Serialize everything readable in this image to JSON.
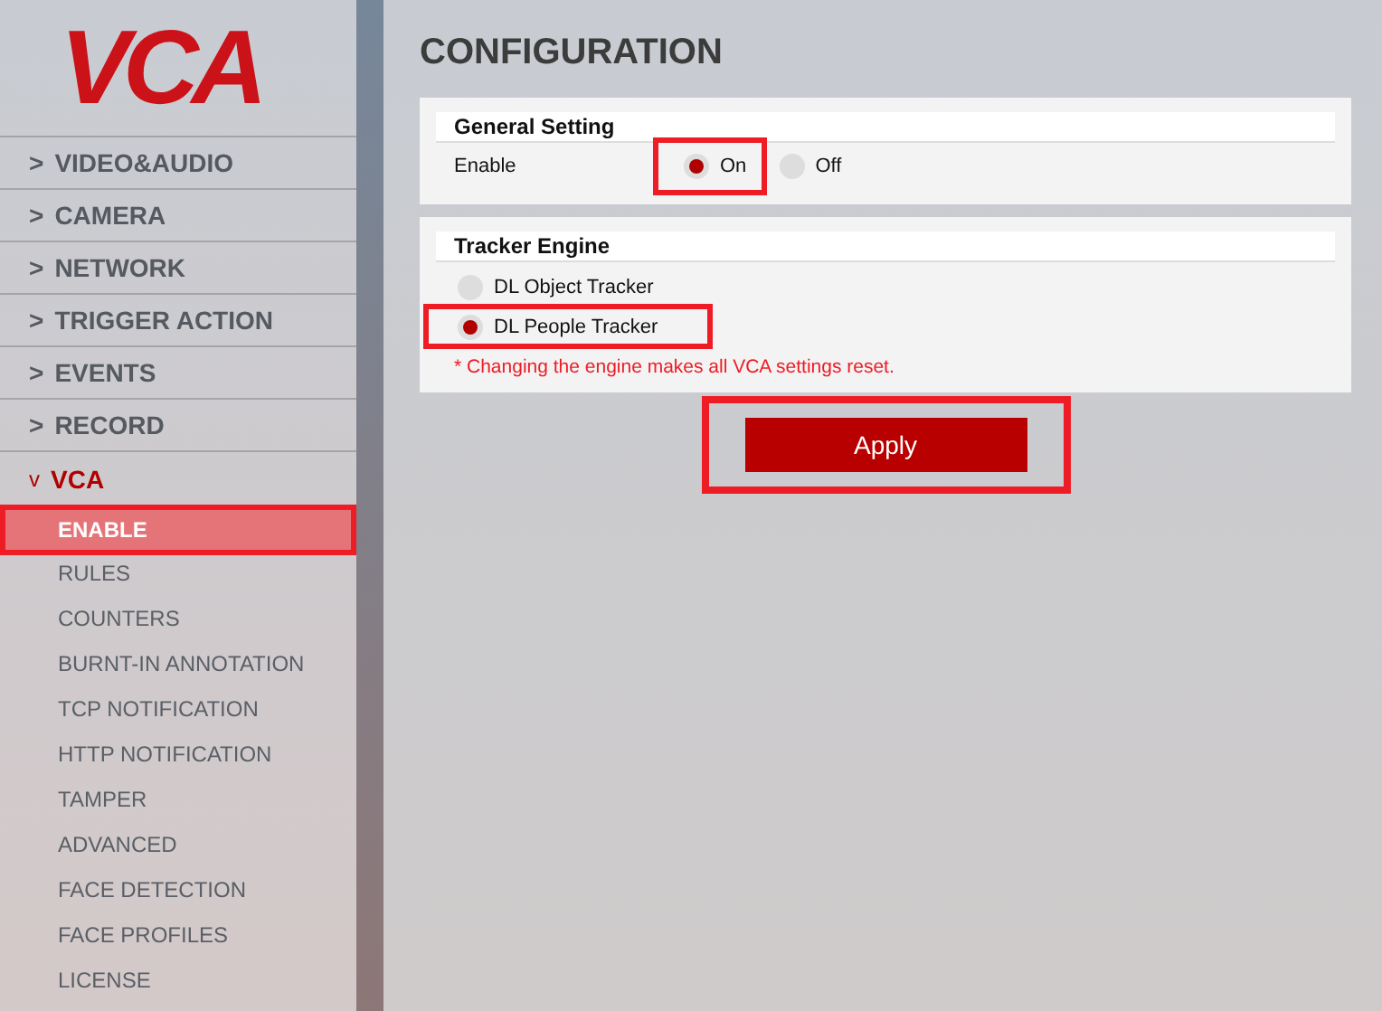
{
  "logo": {
    "text": "VCA"
  },
  "sidebar": {
    "items": [
      {
        "arrow": ">",
        "label": "VIDEO&AUDIO",
        "expanded": false
      },
      {
        "arrow": ">",
        "label": "CAMERA",
        "expanded": false
      },
      {
        "arrow": ">",
        "label": "NETWORK",
        "expanded": false
      },
      {
        "arrow": ">",
        "label": "TRIGGER ACTION",
        "expanded": false
      },
      {
        "arrow": ">",
        "label": "EVENTS",
        "expanded": false
      },
      {
        "arrow": ">",
        "label": "RECORD",
        "expanded": false
      },
      {
        "arrow": "v",
        "label": "VCA",
        "expanded": true,
        "children": [
          {
            "label": "ENABLE",
            "selected": true,
            "highlighted": true
          },
          {
            "label": "RULES",
            "selected": false,
            "highlighted": false
          },
          {
            "label": "COUNTERS",
            "selected": false,
            "highlighted": false
          },
          {
            "label": "BURNT-IN ANNOTATION",
            "selected": false,
            "highlighted": false
          },
          {
            "label": "TCP NOTIFICATION",
            "selected": false,
            "highlighted": false
          },
          {
            "label": "HTTP NOTIFICATION",
            "selected": false,
            "highlighted": false
          },
          {
            "label": "TAMPER",
            "selected": false,
            "highlighted": false
          },
          {
            "label": "ADVANCED",
            "selected": false,
            "highlighted": false
          },
          {
            "label": "FACE DETECTION",
            "selected": false,
            "highlighted": false
          },
          {
            "label": "FACE PROFILES",
            "selected": false,
            "highlighted": false
          },
          {
            "label": "LICENSE",
            "selected": false,
            "highlighted": false
          }
        ]
      }
    ]
  },
  "page_title": "CONFIGURATION",
  "general": {
    "title": "General Setting",
    "label": "Enable",
    "options": [
      {
        "label": "On",
        "selected": true,
        "highlighted": true
      },
      {
        "label": "Off",
        "selected": false,
        "highlighted": false
      }
    ]
  },
  "tracker": {
    "title": "Tracker Engine",
    "options": [
      {
        "label": "DL Object Tracker",
        "selected": false,
        "highlighted": false
      },
      {
        "label": "DL People Tracker",
        "selected": true,
        "highlighted": true
      }
    ],
    "warning": "* Changing the engine makes all VCA settings reset."
  },
  "apply": {
    "label": "Apply",
    "highlighted": true
  }
}
